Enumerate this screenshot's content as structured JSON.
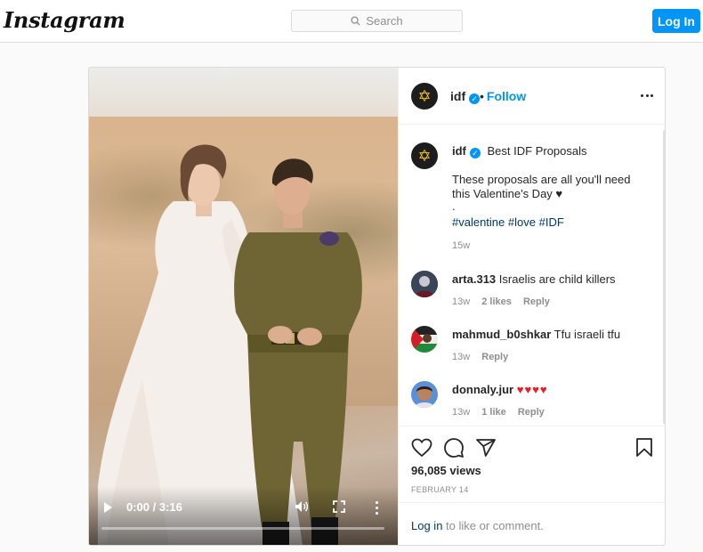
{
  "topbar": {
    "logo": "Instagram",
    "search_placeholder": "Search",
    "login_label": "Log In"
  },
  "video": {
    "time": "0:00 / 3:16",
    "progress": 0
  },
  "post": {
    "username": "idf",
    "follow_label": "Follow",
    "follow_separator": "•",
    "more_icon": "more-horizontal-icon",
    "caption": {
      "username": "idf",
      "title": "Best IDF Proposals",
      "line1": "These proposals are all you'll need",
      "line2": "this Valentine's Day ♥",
      "line3": ".",
      "hashtags": [
        "#valentine",
        "#love",
        "#IDF"
      ],
      "age": "15w"
    },
    "comments": [
      {
        "username": "arta.313",
        "text": "Israelis are child killers",
        "age": "13w",
        "likes": "2 likes",
        "reply": "Reply"
      },
      {
        "username": "mahmud_b0shkar",
        "text": "Tfu israeli tfu",
        "age": "13w",
        "likes": "",
        "reply": "Reply"
      },
      {
        "username": "donnaly.jur",
        "text": "♥♥♥♥",
        "age": "13w",
        "likes": "1 like",
        "reply": "Reply"
      }
    ],
    "views": "96,085 views",
    "date": "FEBRUARY 14",
    "login_prompt": {
      "link": "Log in",
      "rest": " to like or comment."
    }
  },
  "colors": {
    "accent": "#0095f6",
    "link": "#00376b",
    "muted": "#8e8e8e",
    "heart": "#ed1c24"
  }
}
